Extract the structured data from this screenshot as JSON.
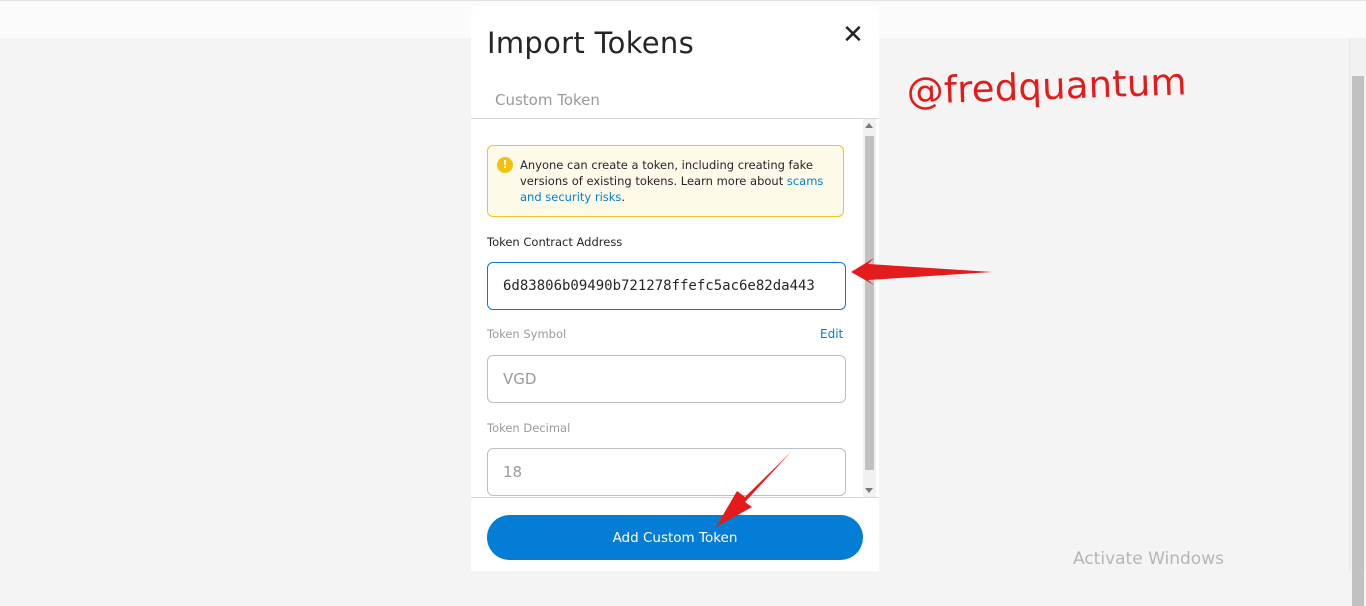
{
  "modal": {
    "title": "Import Tokens",
    "close_symbol": "✕",
    "tab_label": "Custom Token"
  },
  "warning": {
    "icon_glyph": "!",
    "text": "Anyone can create a token, including creating fake versions of existing tokens. Learn more about ",
    "link_text": "scams and security risks",
    "text_end": "."
  },
  "fields": {
    "contract_address": {
      "label": "Token Contract Address",
      "value": "6d83806b09490b721278ffefc5ac6e82da443"
    },
    "symbol": {
      "label": "Token Symbol",
      "edit_label": "Edit",
      "value": "VGD"
    },
    "decimal": {
      "label": "Token Decimal",
      "value": "18"
    }
  },
  "footer": {
    "add_button_label": "Add Custom Token"
  },
  "overlay": {
    "handle": "@fredquantum",
    "os_watermark": "Activate Windows"
  },
  "colors": {
    "accent": "#037dd6",
    "warning_border": "#f3c02a",
    "warning_bg": "#fefae9",
    "annotation_red": "#e51b1b"
  }
}
